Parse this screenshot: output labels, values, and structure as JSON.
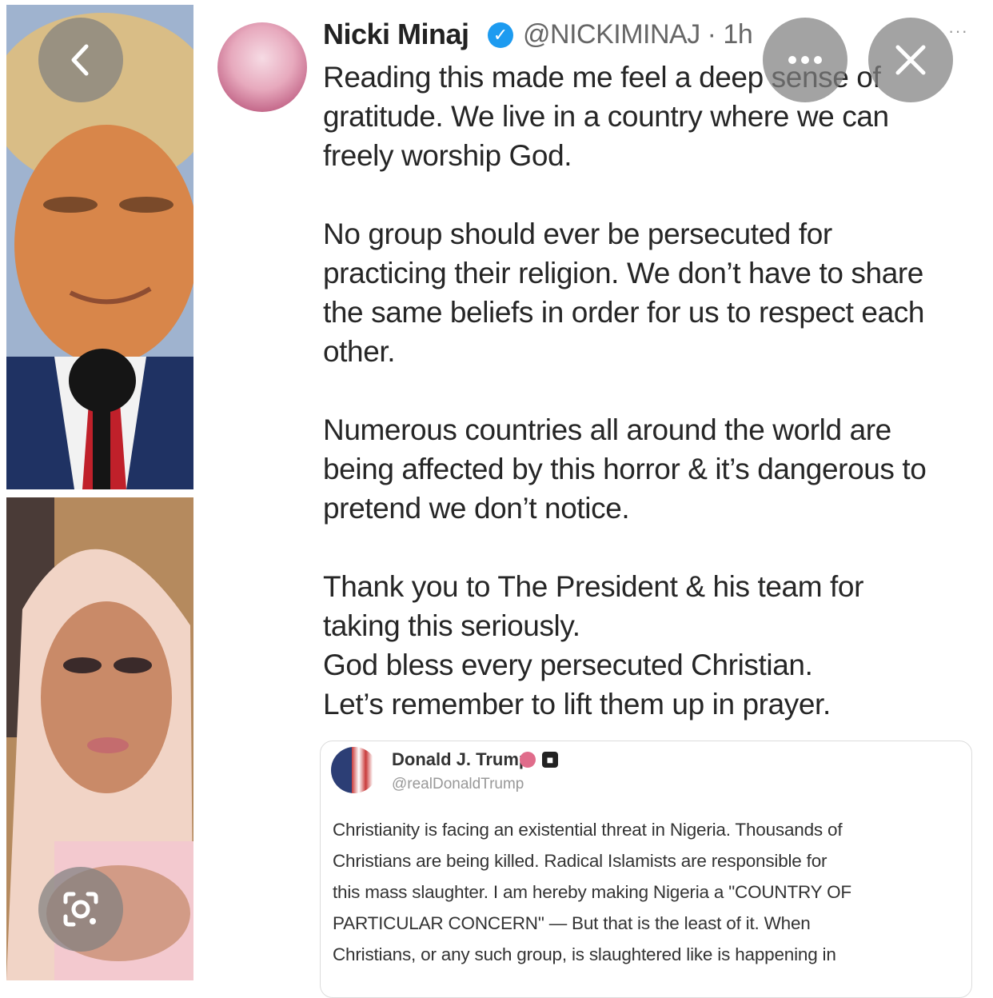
{
  "tweet": {
    "author_name": "Nicki Minaj",
    "verified_mark": "✓",
    "handle_time": "@NICKIMINAJ · 1h",
    "more_glyph": "···",
    "paragraphs": [
      [
        "Reading this made me feel a deep sense of",
        "gratitude. We live in a country where we can",
        "freely worship God."
      ],
      [
        "No group should ever be persecuted for",
        "practicing their religion. We don’t have to share",
        "the same beliefs in order for us to respect each",
        "other."
      ],
      [
        "Numerous countries all around the world are",
        "being affected by this horror & it’s dangerous to",
        "pretend we don’t notice."
      ],
      [
        "Thank you to The President & his team for",
        "taking this seriously.",
        "God bless every persecuted Christian.",
        "Let’s remember to lift them up in prayer."
      ]
    ]
  },
  "quoted_tweet": {
    "author_name": "Donald J. Trump",
    "handle": "@realDonaldTrump",
    "lines": [
      "Christianity is facing an existential threat in Nigeria. Thousands of",
      "Christians are being killed. Radical Islamists are responsible for",
      "this mass slaughter. I am hereby making Nigeria a \"COUNTRY OF",
      "PARTICULAR CONCERN\" — But that is the least of it. When",
      "Christians, or any such group, is slaughtered like is happening in"
    ]
  },
  "viewer_controls": {
    "back_icon": "chevron-left-icon",
    "more_icon": "more-horizontal-icon",
    "close_icon": "close-icon",
    "lens_icon": "lens-icon"
  },
  "colors": {
    "overlay_button": "#808080",
    "verified": "#1d9bf0",
    "text": "#262626"
  }
}
